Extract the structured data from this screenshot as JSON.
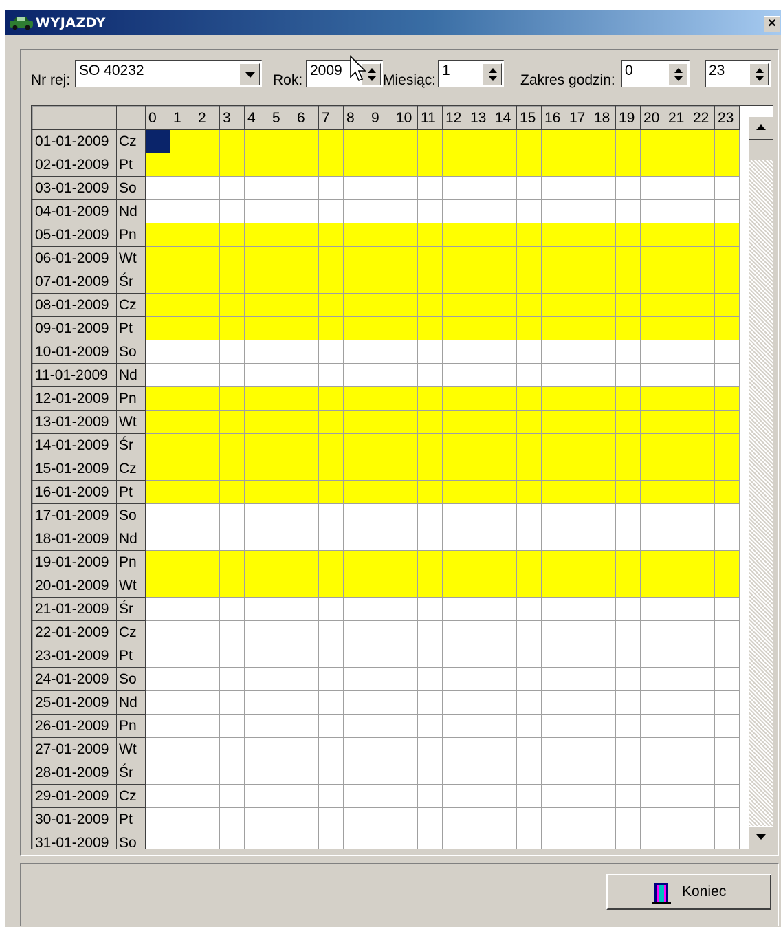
{
  "window": {
    "title": "WYJAZDY",
    "close_glyph": "×"
  },
  "filters": {
    "nr_rej_label": "Nr rej:",
    "nr_rej_value": "SO 40232",
    "rok_label": "Rok:",
    "rok_value": "2009",
    "miesiac_label": "Miesiąc:",
    "miesiac_value": "1",
    "zakres_label": "Zakres godzin:",
    "zakres_from": "0",
    "zakres_to": "23"
  },
  "grid": {
    "hours": [
      "0",
      "1",
      "2",
      "3",
      "4",
      "5",
      "6",
      "7",
      "8",
      "9",
      "10",
      "11",
      "12",
      "13",
      "14",
      "15",
      "16",
      "17",
      "18",
      "19",
      "20",
      "21",
      "22",
      "23"
    ],
    "rows": [
      {
        "date": "01-01-2009",
        "day": "Cz",
        "active": true,
        "selected_hour": 0
      },
      {
        "date": "02-01-2009",
        "day": "Pt",
        "active": true
      },
      {
        "date": "03-01-2009",
        "day": "So",
        "active": false
      },
      {
        "date": "04-01-2009",
        "day": "Nd",
        "active": false
      },
      {
        "date": "05-01-2009",
        "day": "Pn",
        "active": true
      },
      {
        "date": "06-01-2009",
        "day": "Wt",
        "active": true
      },
      {
        "date": "07-01-2009",
        "day": "Śr",
        "active": true
      },
      {
        "date": "08-01-2009",
        "day": "Cz",
        "active": true
      },
      {
        "date": "09-01-2009",
        "day": "Pt",
        "active": true
      },
      {
        "date": "10-01-2009",
        "day": "So",
        "active": false
      },
      {
        "date": "11-01-2009",
        "day": "Nd",
        "active": false
      },
      {
        "date": "12-01-2009",
        "day": "Pn",
        "active": true
      },
      {
        "date": "13-01-2009",
        "day": "Wt",
        "active": true
      },
      {
        "date": "14-01-2009",
        "day": "Śr",
        "active": true
      },
      {
        "date": "15-01-2009",
        "day": "Cz",
        "active": true
      },
      {
        "date": "16-01-2009",
        "day": "Pt",
        "active": true
      },
      {
        "date": "17-01-2009",
        "day": "So",
        "active": false
      },
      {
        "date": "18-01-2009",
        "day": "Nd",
        "active": false
      },
      {
        "date": "19-01-2009",
        "day": "Pn",
        "active": true
      },
      {
        "date": "20-01-2009",
        "day": "Wt",
        "active": true
      },
      {
        "date": "21-01-2009",
        "day": "Śr",
        "active": false
      },
      {
        "date": "22-01-2009",
        "day": "Cz",
        "active": false
      },
      {
        "date": "23-01-2009",
        "day": "Pt",
        "active": false
      },
      {
        "date": "24-01-2009",
        "day": "So",
        "active": false
      },
      {
        "date": "25-01-2009",
        "day": "Nd",
        "active": false
      },
      {
        "date": "26-01-2009",
        "day": "Pn",
        "active": false
      },
      {
        "date": "27-01-2009",
        "day": "Wt",
        "active": false
      },
      {
        "date": "28-01-2009",
        "day": "Śr",
        "active": false
      },
      {
        "date": "29-01-2009",
        "day": "Cz",
        "active": false
      },
      {
        "date": "30-01-2009",
        "day": "Pt",
        "active": false
      },
      {
        "date": "31-01-2009",
        "day": "So",
        "active": false
      }
    ]
  },
  "footer": {
    "koniec_label": "Koniec"
  },
  "colors": {
    "active": "#ffff00",
    "selected": "#0a246a",
    "title_start": "#0a246a",
    "title_end": "#a6caf0",
    "face": "#d4d0c8"
  },
  "icons": {
    "title": "car-icon",
    "close": "close-icon",
    "koniec": "door-exit-icon",
    "spin": "spin-updown-icon",
    "dropdown": "chevron-down-icon"
  }
}
